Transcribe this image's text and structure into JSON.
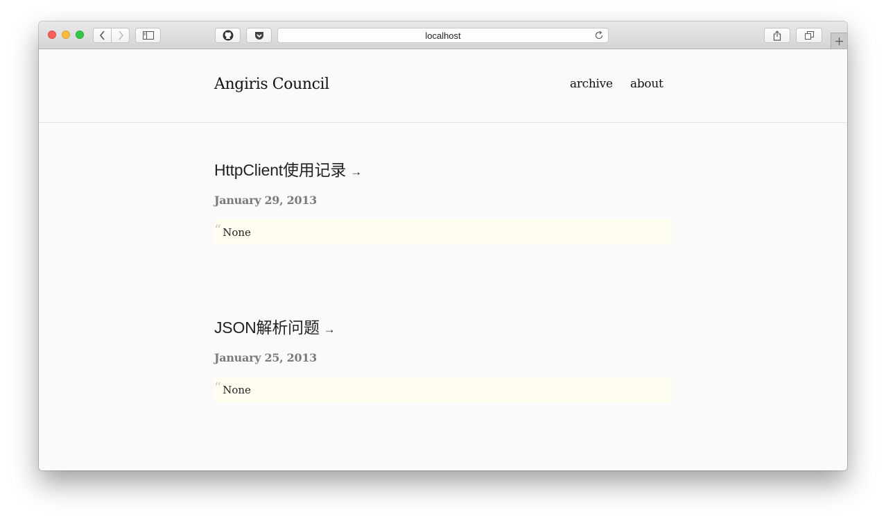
{
  "browser": {
    "url": "localhost"
  },
  "site": {
    "title": "Angiris Council",
    "nav": [
      {
        "label": "archive"
      },
      {
        "label": "about"
      }
    ]
  },
  "posts": [
    {
      "title": "HttpClient使用记录",
      "arrow": "→",
      "date": "January 29, 2013",
      "quote": "“",
      "excerpt": "None"
    },
    {
      "title": "JSON解析问题",
      "arrow": "→",
      "date": "January 25, 2013",
      "quote": "“",
      "excerpt": "None"
    }
  ],
  "colors": {
    "arrow": "#cc1111",
    "excerpt_bg": "#fffdf0",
    "date": "#7a7a7a"
  }
}
